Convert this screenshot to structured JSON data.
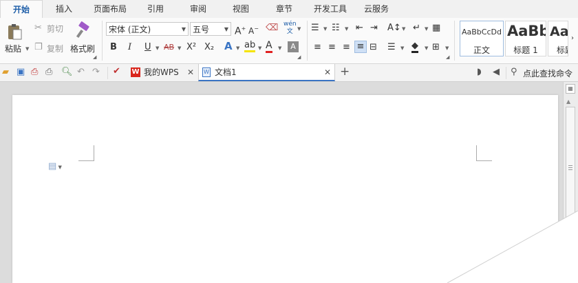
{
  "ribbon_tabs": [
    "开始",
    "插入",
    "页面布局",
    "引用",
    "审阅",
    "视图",
    "章节",
    "开发工具",
    "云服务"
  ],
  "clipboard": {
    "paste": "粘贴",
    "cut": "剪切",
    "copy": "复制",
    "format_painter": "格式刷"
  },
  "font": {
    "name": "宋体 (正文)",
    "size": "五号"
  },
  "font_buttons": {
    "bold": "B",
    "italic": "I",
    "underline": "U",
    "strikethrough": "AB",
    "superscript": "X²",
    "subscript": "X₂",
    "font_color": "A",
    "grow": "A⁺",
    "shrink": "A⁻",
    "phonetic": "wén 文"
  },
  "styles": [
    {
      "preview": "AaBbCcDd",
      "name": "正文"
    },
    {
      "preview": "AaBb",
      "name": "标题 1"
    },
    {
      "preview": "Aa",
      "name": "标题"
    }
  ],
  "doc_tabs": [
    {
      "label": "我的WPS"
    },
    {
      "label": "文档1"
    }
  ],
  "search": {
    "label": "点此查找命令"
  },
  "colors": {
    "accent": "#1e5ea8",
    "wps_red": "#d9261c",
    "highlight": "#f5e400",
    "font_red": "#e02020"
  }
}
